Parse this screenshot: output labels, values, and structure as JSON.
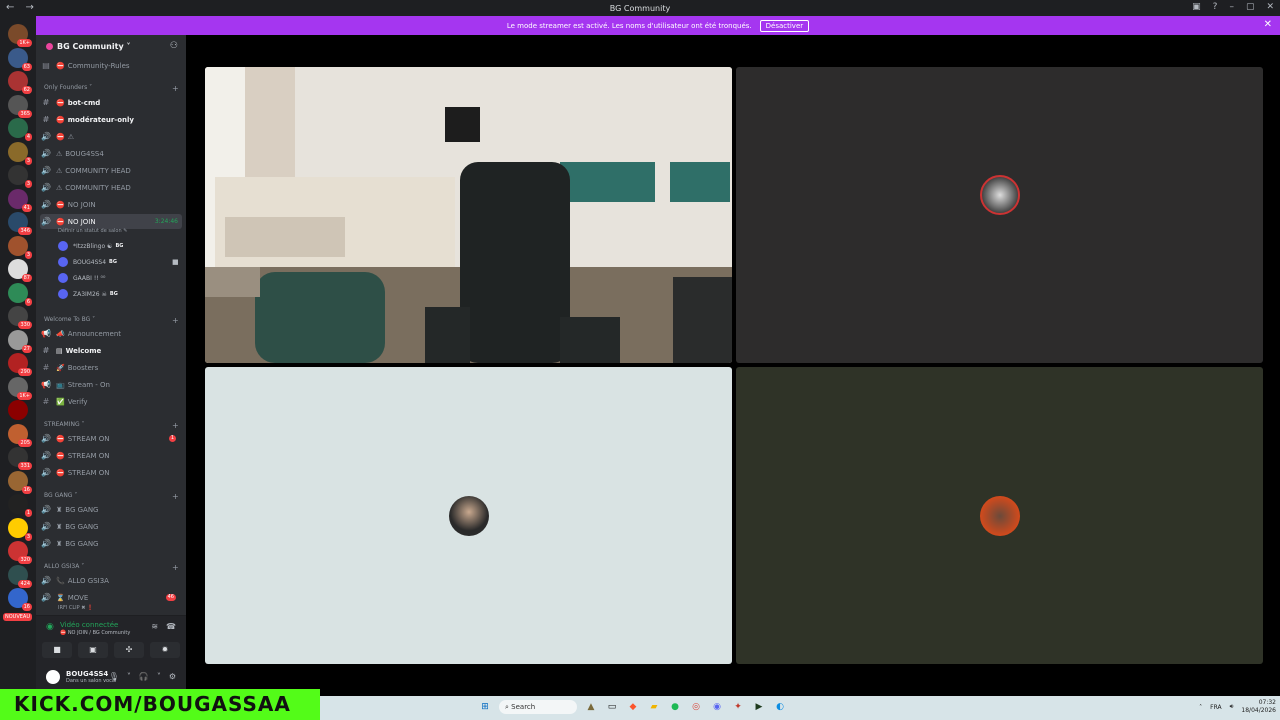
{
  "window": {
    "title": "BG Community",
    "nav": "← →",
    "controls": [
      "▣",
      "?",
      "–",
      "▢",
      "✕"
    ]
  },
  "banner": {
    "text": "Le mode streamer est activé. Les noms d'utilisateur ont été tronqués.",
    "button": "Désactiver",
    "close": "✕"
  },
  "guilds": {
    "badges": [
      "1K+",
      "63",
      "62",
      "365",
      "4",
      "3",
      "3",
      "41",
      "346",
      "3",
      "87",
      "6",
      "330",
      "27",
      "290",
      "1K+",
      "",
      "205",
      "331",
      "16",
      "1",
      "3",
      "320",
      "424",
      "16"
    ],
    "new_label": "NOUVEAU"
  },
  "server": {
    "name": "BG Community ˅",
    "channels_top": [
      {
        "icon": "▤",
        "emoji": "⛔",
        "label": "Community-Rules"
      }
    ],
    "categories": [
      {
        "label": "Only Founders ˅"
      },
      {
        "label": "Welcome To BG ˅"
      },
      {
        "label": "STREAMING ˅"
      },
      {
        "label": "BG GANG ˅"
      },
      {
        "label": "ALLO GSI3A ˅"
      }
    ],
    "founders": [
      {
        "icon": "#",
        "emoji": "⛔",
        "label": "bot-cmd",
        "bold": true
      },
      {
        "icon": "#",
        "emoji": "⛔",
        "label": "modérateur-only",
        "bold": true
      },
      {
        "icon": "🔊",
        "emoji": "⛔",
        "label": "⚠"
      },
      {
        "icon": "🔊",
        "emoji": "⚠",
        "label": "BOUG4SS4"
      },
      {
        "icon": "🔊",
        "emoji": "⚠",
        "label": "COMMUNITY HEAD"
      },
      {
        "icon": "🔊",
        "emoji": "⚠",
        "label": "COMMUNITY HEAD"
      },
      {
        "icon": "🔊",
        "emoji": "⛔",
        "label": "NO JOIN"
      },
      {
        "icon": "🔊",
        "emoji": "⛔",
        "label": "NO JOIN",
        "timer": "3:24:46"
      }
    ],
    "status_hint": "Définir un statut de salon ✎",
    "members": [
      {
        "name": "*ItzzBlingo ☯",
        "tag": "BG"
      },
      {
        "name": "BOUG4SS4",
        "tag": "BG",
        "cam": "■"
      },
      {
        "name": "GAABI !! ⁰⁰",
        "tag": ""
      },
      {
        "name": "ZA3IM26 ☠",
        "tag": "BG"
      }
    ],
    "welcome": [
      {
        "icon": "📢",
        "emoji": "📣",
        "label": "Announcement"
      },
      {
        "icon": "#",
        "emoji": "▤",
        "label": "Welcome",
        "bold": true
      },
      {
        "icon": "#",
        "emoji": "🚀",
        "label": "Boosters"
      },
      {
        "icon": "📢",
        "emoji": "📺",
        "label": "Stream - On"
      },
      {
        "icon": "#",
        "emoji": "✅",
        "label": "Verify"
      }
    ],
    "streaming": [
      {
        "icon": "🔊",
        "emoji": "⛔",
        "label": "STREAM ON",
        "count": "1"
      },
      {
        "icon": "🔊",
        "emoji": "⛔",
        "label": "STREAM ON"
      },
      {
        "icon": "🔊",
        "emoji": "⛔",
        "label": "STREAM ON"
      }
    ],
    "gang": [
      {
        "icon": "🔊",
        "emoji": "♜",
        "label": "BG GANG"
      },
      {
        "icon": "🔊",
        "emoji": "♜",
        "label": "BG GANG"
      },
      {
        "icon": "🔊",
        "emoji": "♜",
        "label": "BG GANG"
      }
    ],
    "allo": [
      {
        "icon": "🔊",
        "emoji": "📞",
        "label": "ALLO GSI3A"
      },
      {
        "icon": "🔊",
        "emoji": "⌛",
        "label": "MOVE",
        "count": "46"
      }
    ],
    "allo_sub": "IRFI CLIP ✖ ❗"
  },
  "voice": {
    "title": "Vidéo connectée",
    "subtitle": "⛔ NO JOIN / BG Community",
    "buttons": [
      "■",
      "▣",
      "✣",
      "✹"
    ]
  },
  "user": {
    "name": "BOUG4SS4",
    "status": "Dans un salon vocal",
    "icons": [
      "🎙",
      "˅",
      "🎧",
      "˅",
      "⚙"
    ]
  },
  "overlay": {
    "kick": "KICK.COM/BOUGASSAA"
  },
  "taskbar": {
    "search": "Search",
    "lang": "FRA",
    "time": "07:32",
    "date": "18/04/2026"
  },
  "colors": {
    "accent": "#a536f0",
    "kick": "#53fc18",
    "online": "#23a55a",
    "badge": "#f23f43"
  }
}
